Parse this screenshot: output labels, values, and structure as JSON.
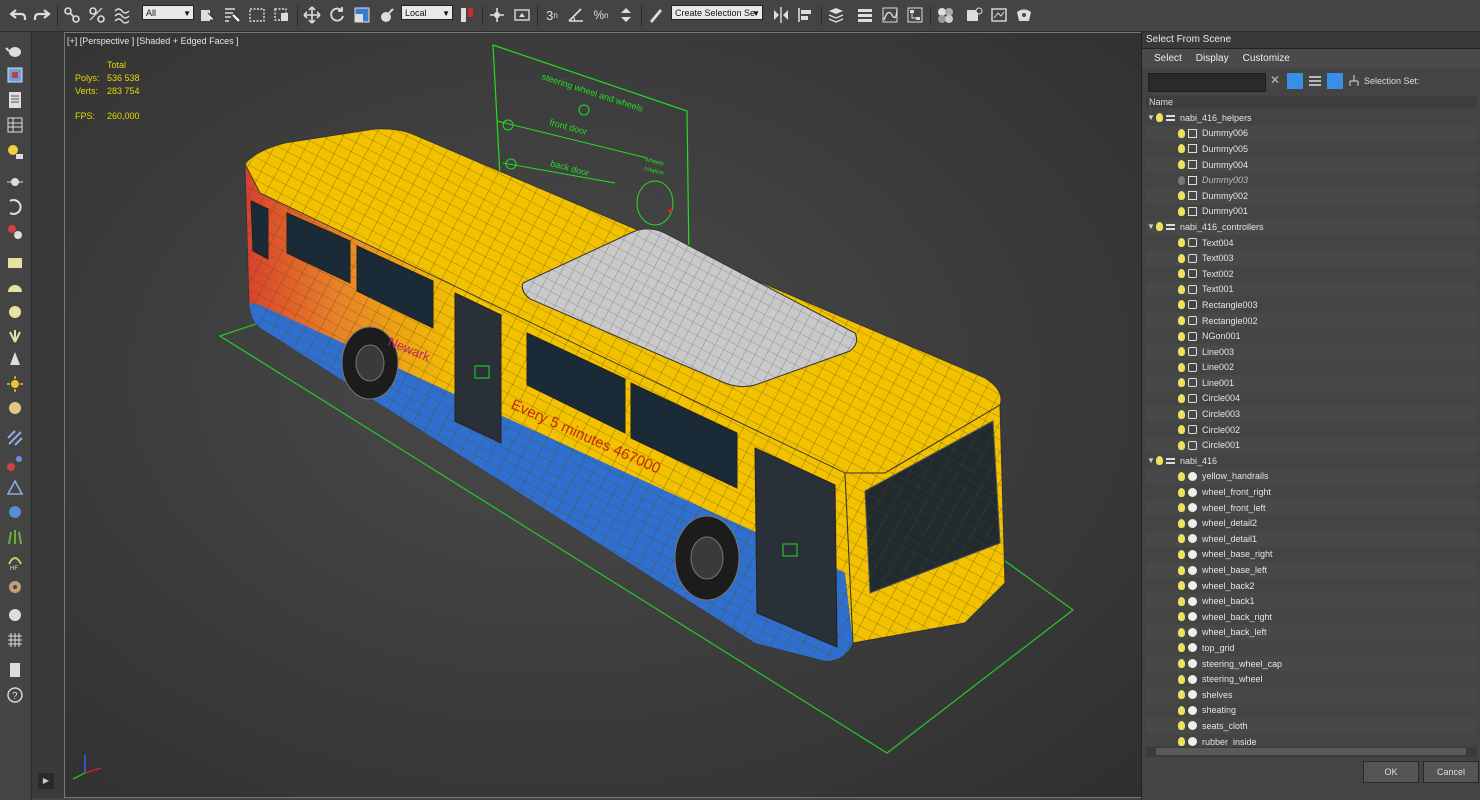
{
  "toolbar": {
    "selection_filter": "All",
    "reference_coord": "Local",
    "named_selection": "Create Selection Se",
    "icons": [
      "undo-icon",
      "redo-icon",
      "link-icon",
      "unlink-icon",
      "bind-spacewarp-icon",
      "select-icon",
      "select-by-name-icon",
      "rect-select-icon",
      "window-crossing-icon",
      "move-icon",
      "rotate-icon",
      "scale-icon",
      "place-icon",
      "pivot-icon",
      "manipulate-icon",
      "keyboard-shortcut-icon",
      "snap-3-icon",
      "angle-snap-icon",
      "percent-snap-icon",
      "spinner-snap-icon",
      "edit-named-sets-icon",
      "mirror-icon",
      "align-icon",
      "scene-explorer-icon",
      "layer-explorer-icon",
      "ribbon-icon",
      "curve-editor-icon",
      "schematic-icon",
      "material-editor-icon",
      "render-setup-icon",
      "rendered-frame-icon",
      "render-icon"
    ]
  },
  "viewport": {
    "label": "[+] [Perspective ] [Shaded + Edged Faces ]",
    "stats_header": "Total",
    "polys_label": "Polys:",
    "polys_value": "536 538",
    "verts_label": "Verts:",
    "verts_value": "283 754",
    "fps_label": "FPS:",
    "fps_value": "260,000",
    "controller_labels": {
      "steering": "steering wheel and wheels",
      "front_door": "front door",
      "back_door": "back door",
      "wheels_rotation_1": "wheels",
      "wheels_rotation_2": "rotation"
    },
    "bus_text_1": "Newark",
    "bus_text_2": "Every 5 minutes 467000"
  },
  "panel": {
    "title": "Select From Scene",
    "menu": [
      "Select",
      "Display",
      "Customize"
    ],
    "selection_set_label": "Selection Set:",
    "column_header": "Name",
    "rows": [
      {
        "label": "nabi_416_helpers",
        "level": 0,
        "type": "layer",
        "expanded": true
      },
      {
        "label": "Dummy006",
        "level": 1,
        "type": "helper"
      },
      {
        "label": "Dummy005",
        "level": 1,
        "type": "helper"
      },
      {
        "label": "Dummy004",
        "level": 1,
        "type": "helper"
      },
      {
        "label": "Dummy003",
        "level": 1,
        "type": "helper",
        "hidden": true
      },
      {
        "label": "Dummy002",
        "level": 1,
        "type": "helper"
      },
      {
        "label": "Dummy001",
        "level": 1,
        "type": "helper"
      },
      {
        "label": "nabi_416_controllers",
        "level": 0,
        "type": "layer",
        "expanded": true
      },
      {
        "label": "Text004",
        "level": 1,
        "type": "shape"
      },
      {
        "label": "Text003",
        "level": 1,
        "type": "shape"
      },
      {
        "label": "Text002",
        "level": 1,
        "type": "shape"
      },
      {
        "label": "Text001",
        "level": 1,
        "type": "shape"
      },
      {
        "label": "Rectangle003",
        "level": 1,
        "type": "shape"
      },
      {
        "label": "Rectangle002",
        "level": 1,
        "type": "shape"
      },
      {
        "label": "NGon001",
        "level": 1,
        "type": "shape"
      },
      {
        "label": "Line003",
        "level": 1,
        "type": "shape"
      },
      {
        "label": "Line002",
        "level": 1,
        "type": "shape"
      },
      {
        "label": "Line001",
        "level": 1,
        "type": "shape"
      },
      {
        "label": "Circle004",
        "level": 1,
        "type": "shape"
      },
      {
        "label": "Circle003",
        "level": 1,
        "type": "shape"
      },
      {
        "label": "Circle002",
        "level": 1,
        "type": "shape"
      },
      {
        "label": "Circle001",
        "level": 1,
        "type": "shape"
      },
      {
        "label": "nabi_416",
        "level": 0,
        "type": "layer",
        "expanded": true
      },
      {
        "label": "yellow_handrails",
        "level": 1,
        "type": "sphere"
      },
      {
        "label": "wheel_front_right",
        "level": 1,
        "type": "sphere"
      },
      {
        "label": "wheel_front_left",
        "level": 1,
        "type": "sphere"
      },
      {
        "label": "wheel_detail2",
        "level": 1,
        "type": "sphere"
      },
      {
        "label": "wheel_detail1",
        "level": 1,
        "type": "sphere"
      },
      {
        "label": "wheel_base_right",
        "level": 1,
        "type": "sphere"
      },
      {
        "label": "wheel_base_left",
        "level": 1,
        "type": "sphere"
      },
      {
        "label": "wheel_back2",
        "level": 1,
        "type": "sphere"
      },
      {
        "label": "wheel_back1",
        "level": 1,
        "type": "sphere"
      },
      {
        "label": "wheel_back_right",
        "level": 1,
        "type": "sphere"
      },
      {
        "label": "wheel_back_left",
        "level": 1,
        "type": "sphere"
      },
      {
        "label": "top_grid",
        "level": 1,
        "type": "sphere"
      },
      {
        "label": "steering_wheel_cap",
        "level": 1,
        "type": "sphere"
      },
      {
        "label": "steering_wheel",
        "level": 1,
        "type": "sphere"
      },
      {
        "label": "shelves",
        "level": 1,
        "type": "sphere"
      },
      {
        "label": "sheating",
        "level": 1,
        "type": "sphere"
      },
      {
        "label": "seats_cloth",
        "level": 1,
        "type": "sphere"
      },
      {
        "label": "rubber_inside",
        "level": 1,
        "type": "sphere"
      }
    ],
    "ok_label": "OK",
    "cancel_label": "Cancel"
  },
  "colors": {
    "bus_yellow": "#f2c100",
    "bus_orange": "#e8822a",
    "bus_red": "#d8402e",
    "bus_blue": "#2f6fd0",
    "gizmo_green": "#22dd22",
    "stats_yellow": "#e8d800",
    "selection_blue": "#3a8ee6"
  }
}
